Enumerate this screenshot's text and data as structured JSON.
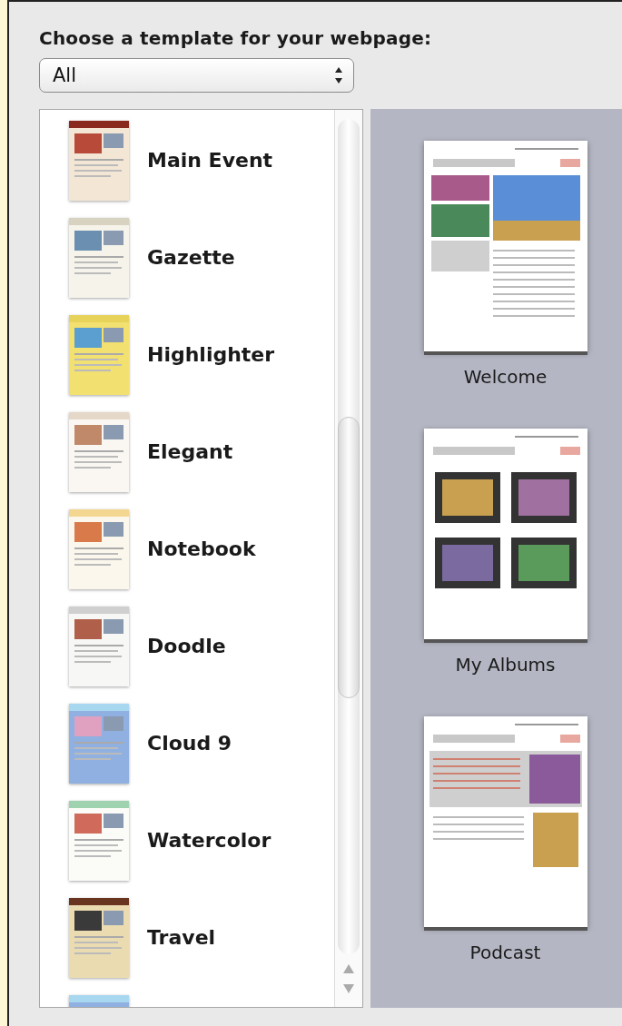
{
  "heading": "Choose a template for your webpage:",
  "filter": {
    "value": "All"
  },
  "templates": [
    {
      "label": "Main Event",
      "kind": "event"
    },
    {
      "label": "Gazette",
      "kind": "gazette"
    },
    {
      "label": "Highlighter",
      "kind": "highlighter"
    },
    {
      "label": "Elegant",
      "kind": "elegant"
    },
    {
      "label": "Notebook",
      "kind": "notebook"
    },
    {
      "label": "Doodle",
      "kind": "doodle"
    },
    {
      "label": "Cloud 9",
      "kind": "cloud"
    },
    {
      "label": "Watercolor",
      "kind": "watercolor"
    },
    {
      "label": "Travel",
      "kind": "travel"
    },
    {
      "kind": "cloud"
    }
  ],
  "pages": [
    {
      "label": "Welcome",
      "kind": "welcome"
    },
    {
      "label": "My Albums",
      "kind": "albums"
    },
    {
      "label": "Podcast",
      "kind": "podcast"
    }
  ]
}
